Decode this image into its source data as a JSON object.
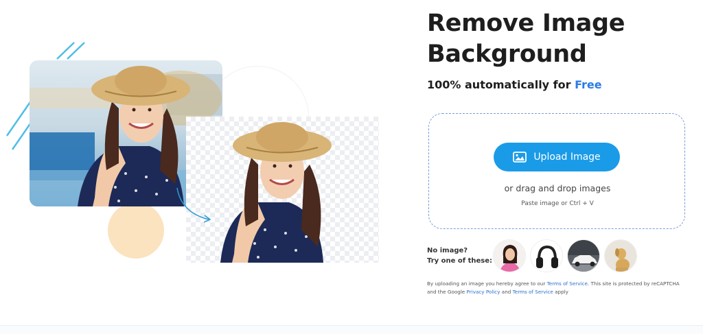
{
  "hero": {
    "original_photo": "woman-in-sunhat-photo",
    "cutout_photo": "woman-in-sunhat-cutout",
    "colors": {
      "stripes": "#4fbde8",
      "peach_circle": "#fbe3bf",
      "arrow": "#2a9bd6"
    }
  },
  "header": {
    "title_line1": "Remove Image",
    "title_line2": "Background",
    "subtitle_prefix": "100% automatically for ",
    "subtitle_free": "Free"
  },
  "upload": {
    "button_label": "Upload Image",
    "button_icon": "image-icon",
    "drag_text": "or drag and drop images",
    "paste_text": "Paste image or Ctrl + V",
    "colors": {
      "button": "#1a9be8",
      "dropzone_border": "#7a9bd8"
    }
  },
  "samples": {
    "prompt_line1": "No image?",
    "prompt_line2": "Try one of these:",
    "items": [
      {
        "name": "woman-sample"
      },
      {
        "name": "headphones-sample"
      },
      {
        "name": "car-sample"
      },
      {
        "name": "dog-sample"
      }
    ]
  },
  "legal": {
    "part1": "By uploading an image you hereby agree to our ",
    "terms_link": "Terms of Service",
    "part2": ". This site is protected by reCAPTCHA and the Google ",
    "privacy_link": "Privacy Policy",
    "part3": " and ",
    "terms_link2": "Terms of Service",
    "part4": " apply"
  },
  "accent": "#2b7be4"
}
